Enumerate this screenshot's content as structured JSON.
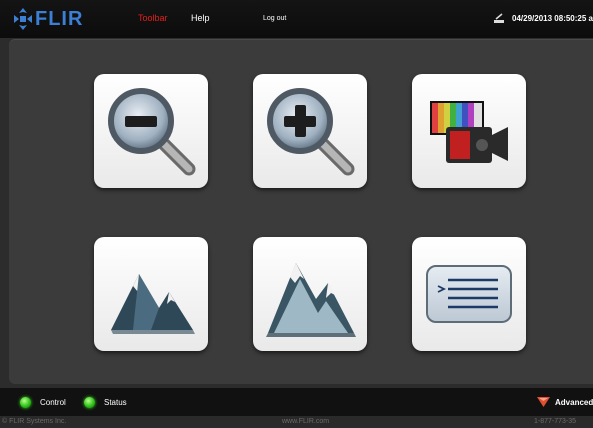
{
  "header": {
    "logo_text": "FLIR",
    "nav": [
      {
        "label": "Toolbar",
        "active": true
      },
      {
        "label": "Help",
        "active": false
      },
      {
        "label": "Log out",
        "active": false
      }
    ],
    "datetime": "04/29/2013 08:50:25 a"
  },
  "tiles": [
    {
      "icon": "zoom-out-icon"
    },
    {
      "icon": "zoom-in-icon"
    },
    {
      "icon": "color-palette-camera-icon"
    },
    {
      "icon": "mountain-icon"
    },
    {
      "icon": "mountain-enhance-icon"
    },
    {
      "icon": "menu-list-icon"
    }
  ],
  "statusbar": {
    "control_label": "Control",
    "status_label": "Status",
    "advanced_label": "Advanced",
    "indicator_color": "#2fc21a"
  },
  "footer": {
    "copyright": "© FLIR Systems Inc.",
    "website": "www.FLIR.com",
    "phone": "1-877-773-35"
  },
  "colors": {
    "brand_blue": "#3c7fd4",
    "active_nav": "#e0201c"
  }
}
